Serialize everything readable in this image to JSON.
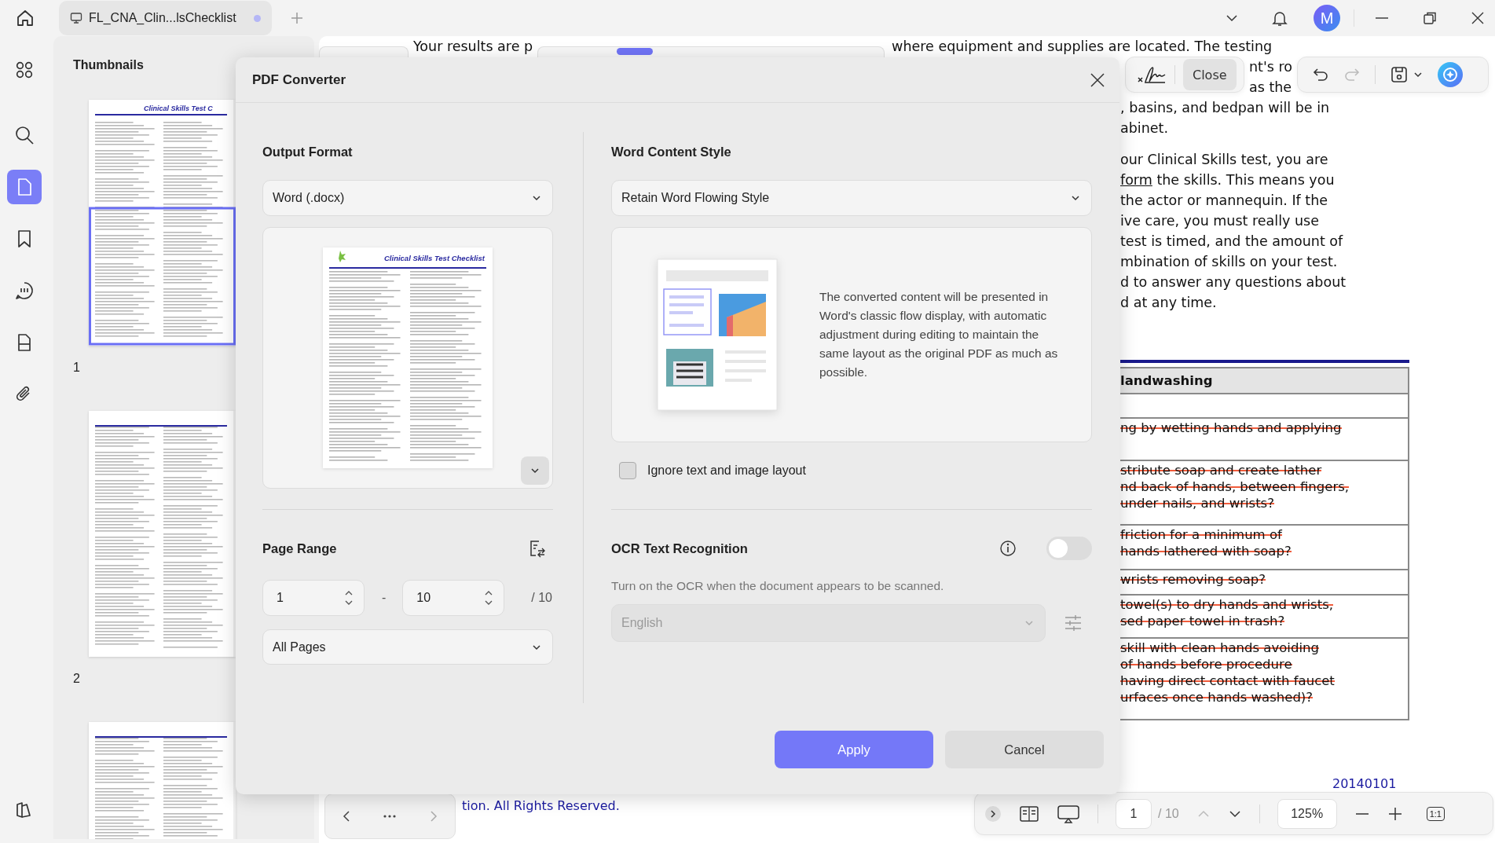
{
  "tabs": [
    {
      "label": "FL_CNA_Clin...lsChecklist",
      "selected": true,
      "modified": true
    }
  ],
  "user": {
    "initial": "M"
  },
  "rail_items": [
    {
      "kind": "grid",
      "selected": false
    },
    {
      "kind": "search",
      "selected": false
    },
    {
      "kind": "page",
      "selected": true
    },
    {
      "kind": "bookmark",
      "selected": false
    },
    {
      "kind": "comment",
      "selected": false
    },
    {
      "kind": "form",
      "selected": false
    },
    {
      "kind": "attachment",
      "selected": false
    },
    {
      "kind": "theme",
      "selected": false
    }
  ],
  "thumbnails_panel": {
    "title": "Thumbnails",
    "pages": [
      {
        "title": "Clinical Skills Test C",
        "number": "1",
        "selected": true
      },
      {
        "number": "2",
        "selected": false
      },
      {
        "selected": false
      }
    ]
  },
  "document": {
    "top_line": {
      "left": "Your results are p",
      "right": "where equipment and supplies are located. The testing"
    },
    "lines": [
      {
        "text": "nt's ro"
      },
      {
        "text": "as the"
      },
      {
        "text": ", basins, and bedpan will be in"
      },
      {
        "text": "abinet."
      },
      {
        "text": "our Clinical Skills test, you are"
      },
      {
        "link": "form",
        "text": " the skills. This means you"
      },
      {
        "text": "the actor or mannequin. If the"
      },
      {
        "text": "ive care, you must really use"
      },
      {
        "text": "test is timed, and the amount of"
      },
      {
        "text": "mbination of skills on your test."
      },
      {
        "text": "d to answer any questions about"
      },
      {
        "text": "d at any time."
      }
    ],
    "table": {
      "header": "landwashing",
      "rows": [
        {
          "struck": false
        },
        {
          "lines": [
            "ng by wetting hands and applying"
          ],
          "struck": true
        },
        {
          "lines": [
            "stribute soap and create lather",
            "nd back of hands, between fingers,",
            "under nails, and wrists?"
          ],
          "struck": true
        },
        {
          "lines": [
            "friction for a minimum of",
            "hands lathered with soap?"
          ],
          "struck": true
        },
        {
          "lines": [
            "wrists removing soap?"
          ],
          "struck": true
        },
        {
          "lines": [
            "towel(s) to dry hands and wrists,",
            "sed paper towel in trash?"
          ],
          "struck": true
        },
        {
          "lines": [
            "skill with clean hands avoiding",
            "of hands before procedure",
            "having direct contact with faucet",
            "urfaces once hands washed)?"
          ],
          "struck": true
        }
      ]
    },
    "date": "20140101",
    "copyright": "tion. All Rights Reserved."
  },
  "sign_toolbar": {
    "close": "Close"
  },
  "view_toolbar": {
    "page": "1",
    "total": "/ 10",
    "zoom": "125%",
    "actual_size": "1:1"
  },
  "dialog": {
    "title": "PDF Converter",
    "output_format": {
      "label": "Output Format",
      "value": "Word (.docx)",
      "preview_title": "Clinical Skills Test Checklist"
    },
    "page_range": {
      "label": "Page Range",
      "from": "1",
      "separator": "-",
      "to": "10",
      "total": "/ 10",
      "scope": "All Pages"
    },
    "content_style": {
      "label": "Word Content Style",
      "value": "Retain Word Flowing Style",
      "description": "The converted content will be presented in Word's classic flow display, with automatic adjustment during editing to maintain the same layout as the original PDF as much as possible."
    },
    "ignore_layout": {
      "label": "Ignore text and image layout",
      "checked": false
    },
    "ocr": {
      "label": "OCR Text Recognition",
      "on": false,
      "hint": "Turn on the OCR when the document appears to be scanned.",
      "language": "English",
      "disabled": true
    },
    "buttons": [
      {
        "label": "Apply",
        "kind": "primary"
      },
      {
        "label": "Cancel",
        "kind": "secondary"
      }
    ]
  }
}
